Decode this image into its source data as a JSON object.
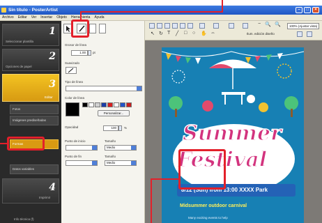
{
  "window": {
    "title": "Sin título - PosterArtist"
  },
  "menu": [
    "Archivo",
    "Editar",
    "Ver",
    "Insertar",
    "Objeto",
    "Herramienta",
    "Ayuda"
  ],
  "steps": [
    {
      "num": "1",
      "label": "Seleccionar plantilla"
    },
    {
      "num": "2",
      "label": "Opciones de papel"
    },
    {
      "num": "3",
      "label": "Editar"
    },
    {
      "num": "4",
      "label": "Imprimir"
    }
  ],
  "substeps": [
    "Fotos",
    "Imágenes prediseñadas",
    "Formas",
    "Datos variables"
  ],
  "bottom_label": "Info técnica (f)",
  "props": {
    "size_label": "Grosor de línea",
    "size_value": "1.00",
    "size_unit": "pt",
    "smoothing_label": "Suavizado",
    "line_type_label": "Tipo de línea",
    "color_label": "Color de línea",
    "customize_label": "Personalizar...",
    "opacity_label": "Opacidad",
    "opacity_value": "100",
    "opacity_unit": "%",
    "start_label": "Punto de inicio",
    "end_label": "Punto de fin",
    "size_col_label": "Tamaño",
    "start_size": "Medio",
    "end_size": "Medio"
  },
  "toolbar": {
    "zoom": "100% (Ajustar vista)",
    "mode_label": "Ilum. edición diseño"
  },
  "poster": {
    "title_line1": "Summer",
    "title_line2": "Festival",
    "date_line": "8/12 (Sun) from 13:00  XXXX Park",
    "subtitle": "Midsummer outdoor carnival",
    "body": "Many exciting events to help"
  },
  "colors": {
    "accent_highlight": "#e3202a",
    "step_active": "#f3c322",
    "poster_bg": "#1780b4",
    "title_pink": "#d3337e"
  }
}
